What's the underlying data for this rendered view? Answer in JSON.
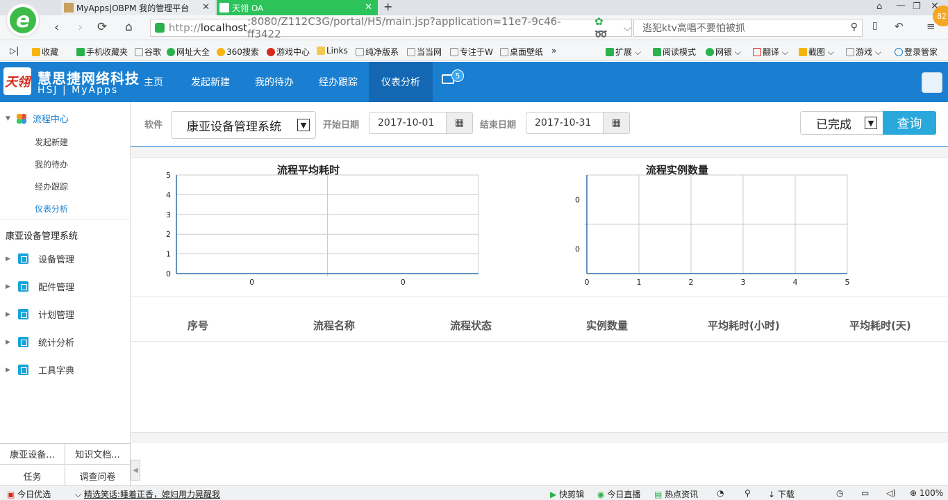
{
  "browser": {
    "tabs": [
      {
        "title": "MyApps|OBPM 我的管理平台",
        "active": false
      },
      {
        "title": "天翎 OA",
        "active": true
      }
    ],
    "url_protocol": "http://",
    "url_host": "localhost",
    "url_rest": ":8080/Z112C3G/portal/H5/main.jsp?application=11e7-9c46-ff3422",
    "search_placeholder": "逃犯ktv高唱不要怕被抓",
    "badge": "82",
    "bookmarks": [
      "收藏",
      "手机收藏夹",
      "谷歌",
      "网址大全",
      "360搜索",
      "游戏中心",
      "Links",
      "纯净版系",
      "当当网",
      "专注于W",
      "桌面壁纸",
      "»"
    ],
    "tools": [
      "扩展",
      "阅读模式",
      "网银",
      "翻译",
      "截图",
      "游戏",
      "登录管家"
    ]
  },
  "app": {
    "name": "慧思捷网络科技",
    "sub_left": "HSJ",
    "sub_right": "MyApps",
    "logo_text": "天翎",
    "nav": [
      "主页",
      "发起新建",
      "我的待办",
      "经办跟踪",
      "仪表分析"
    ],
    "message_count": "5"
  },
  "sidebar": {
    "section": "流程中心",
    "sub_items": [
      "发起新建",
      "我的待办",
      "经办跟踪",
      "仪表分析"
    ],
    "system_title": "康亚设备管理系统",
    "modules": [
      "设备管理",
      "配件管理",
      "计划管理",
      "统计分析",
      "工具字典"
    ],
    "bottom_tabs": [
      "康亚设备...",
      "知识文档...",
      "任务",
      "调查问卷"
    ]
  },
  "filters": {
    "software_label": "软件",
    "software_value": "康亚设备管理系统",
    "start_label": "开始日期",
    "start_value": "2017-10-01",
    "end_label": "结束日期",
    "end_value": "2017-10-31",
    "status_value": "已完成",
    "query_label": "查询"
  },
  "chart_data": [
    {
      "type": "bar",
      "title": "流程平均耗时",
      "categories": [
        "0",
        "0"
      ],
      "values": [
        0,
        0
      ],
      "ylim": [
        0,
        5
      ],
      "yticks": [
        "0",
        "1",
        "2",
        "3",
        "4",
        "5"
      ],
      "grid": true
    },
    {
      "type": "bar",
      "orientation": "horizontal",
      "title": "流程实例数量",
      "categories": [
        "0",
        "0"
      ],
      "values": [
        0,
        0
      ],
      "xlim": [
        0,
        5
      ],
      "xticks": [
        "0",
        "1",
        "2",
        "3",
        "4",
        "5"
      ],
      "grid": true
    }
  ],
  "table": {
    "headers": [
      "序号",
      "流程名称",
      "流程状态",
      "实例数量",
      "平均耗时(小时)",
      "平均耗时(天)"
    ]
  },
  "statusbar": {
    "left": [
      "今日优选",
      "精选笑话:睡着正香，媳妇用力晃醒我"
    ],
    "right": [
      "快剪辑",
      "今日直播",
      "热点资讯",
      "下载",
      "100%"
    ]
  }
}
